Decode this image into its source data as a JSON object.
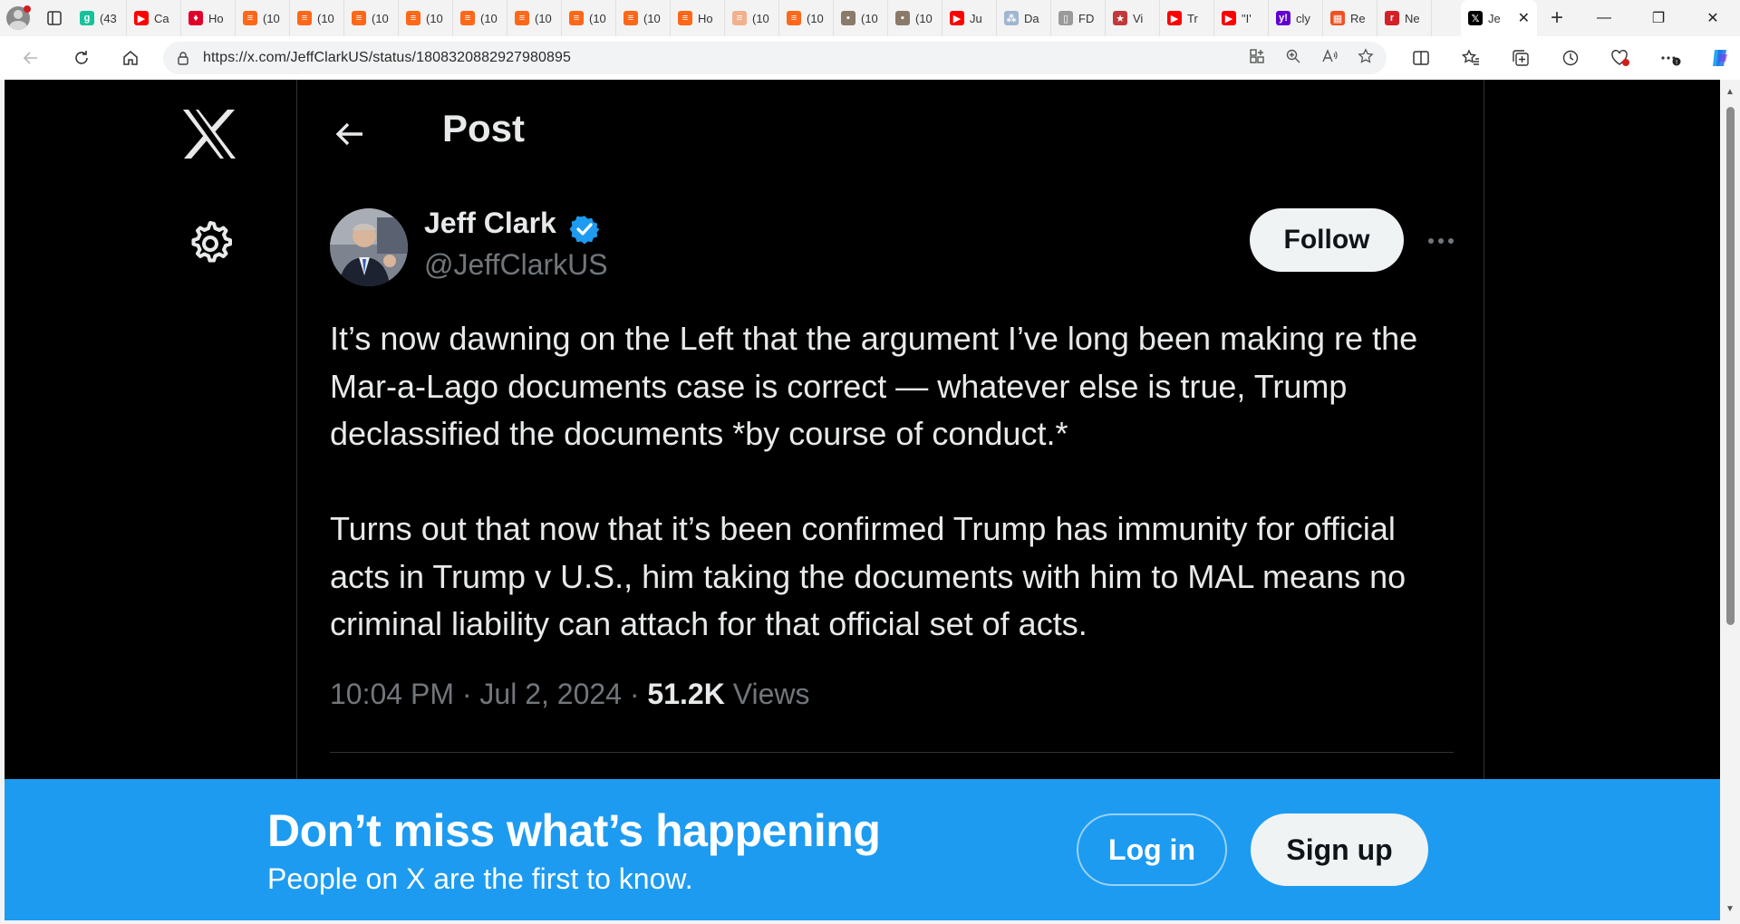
{
  "browser": {
    "tabs": [
      {
        "label": "(43",
        "icon": "grammarly-icon",
        "color": "#15c39a"
      },
      {
        "label": "Ca",
        "icon": "youtube-icon",
        "color": "#ff0000"
      },
      {
        "label": "Ho",
        "icon": "bookmark-red-icon",
        "color": "#e0002a"
      },
      {
        "label": "(10",
        "icon": "substack-icon",
        "color": "#ff6719"
      },
      {
        "label": "(10",
        "icon": "substack-icon",
        "color": "#ff6719"
      },
      {
        "label": "(10",
        "icon": "substack-icon",
        "color": "#ff6719"
      },
      {
        "label": "(10",
        "icon": "substack-icon",
        "color": "#ff6719"
      },
      {
        "label": "(10",
        "icon": "substack-icon",
        "color": "#ff6719"
      },
      {
        "label": "(10",
        "icon": "substack-icon",
        "color": "#ff6719"
      },
      {
        "label": "(10",
        "icon": "substack-icon",
        "color": "#ff6719"
      },
      {
        "label": "(10",
        "icon": "substack-icon",
        "color": "#ff6719"
      },
      {
        "label": "Ho",
        "icon": "substack-icon",
        "color": "#ff6719"
      },
      {
        "label": "(10",
        "icon": "substack-light-icon",
        "color": "#f3b08e"
      },
      {
        "label": "(10",
        "icon": "substack-icon",
        "color": "#ff6719"
      },
      {
        "label": "(10",
        "icon": "photo-icon",
        "color": "#8a7a6a"
      },
      {
        "label": "(10",
        "icon": "photo-icon",
        "color": "#8a7a6a"
      },
      {
        "label": "Ju",
        "icon": "youtube-icon",
        "color": "#ff0000"
      },
      {
        "label": "Da",
        "icon": "network-icon",
        "color": "#9fb5d0"
      },
      {
        "label": "FD",
        "icon": "document-icon",
        "color": "#9a9a9a"
      },
      {
        "label": "Vi",
        "icon": "star-icon",
        "color": "#c0393b"
      },
      {
        "label": "Tr",
        "icon": "youtube-icon",
        "color": "#ff0000"
      },
      {
        "label": "\"I'",
        "icon": "youtube-icon",
        "color": "#ff0000"
      },
      {
        "label": "cly",
        "icon": "yahoo-icon",
        "color": "#6001d2"
      },
      {
        "label": "Re",
        "icon": "microsoft-icon",
        "color": "#f25022"
      },
      {
        "label": "Ne",
        "icon": "red-r-icon",
        "color": "#d61f26"
      }
    ],
    "active_tab": {
      "label": "Je"
    },
    "url": "https://x.com/JeffClarkUS/status/1808320882927980895"
  },
  "sidebar": {
    "logo": "x-logo",
    "settings_icon": "gear-icon"
  },
  "header": {
    "title": "Post"
  },
  "post": {
    "author_name": "Jeff Clark",
    "author_handle": "@JeffClarkUS",
    "verified": true,
    "verified_color": "#1d9bf0",
    "follow_label": "Follow",
    "paragraphs": [
      "It’s now dawning on the Left that the argument I’ve long been making re the Mar-a-Lago documents case is correct — whatever else is true, Trump declassified the documents *by course of conduct.*",
      "Turns out that now that it’s been confirmed Trump has immunity for official acts in Trump v U.S., him taking the documents with him to MAL means no criminal liability can attach for that official set of acts."
    ],
    "time": "10:04 PM",
    "date": "Jul 2, 2024",
    "views_count": "51.2K",
    "views_label": "Views"
  },
  "banner": {
    "title": "Don’t miss what’s happening",
    "subtitle": "People on X are the first to know.",
    "login_label": "Log in",
    "signup_label": "Sign up",
    "color": "#1d9bf0"
  }
}
